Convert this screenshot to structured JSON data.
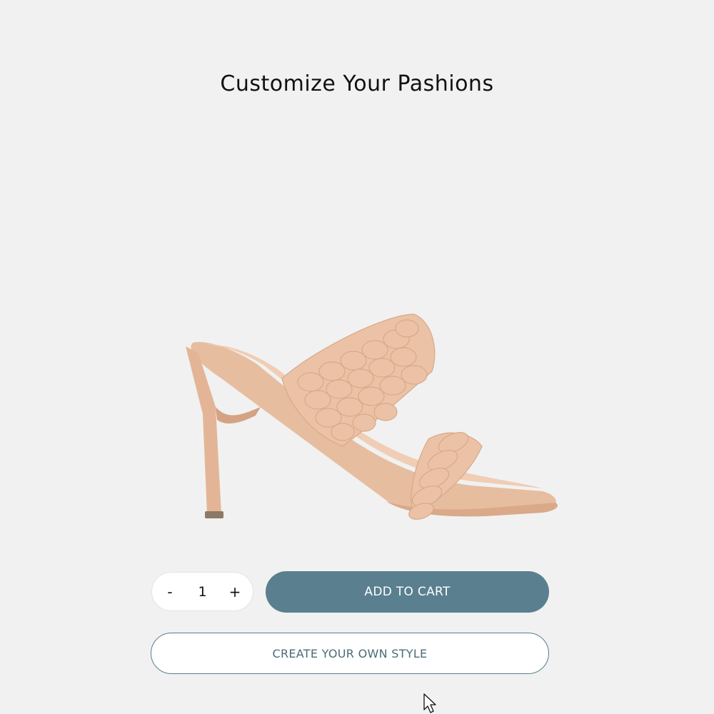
{
  "header": {
    "title": "Customize Your Pashions"
  },
  "product": {
    "image_icon": "high-heel-sandal-image",
    "color": "#e9c3a8"
  },
  "quantity": {
    "decrement_label": "-",
    "value": "1",
    "increment_label": "+"
  },
  "actions": {
    "add_to_cart_label": "ADD TO CART",
    "create_style_label": "CREATE YOUR OWN STYLE"
  },
  "colors": {
    "background": "#f1f1f1",
    "accent": "#5a7f8e",
    "outline_text": "#4b6b78"
  }
}
